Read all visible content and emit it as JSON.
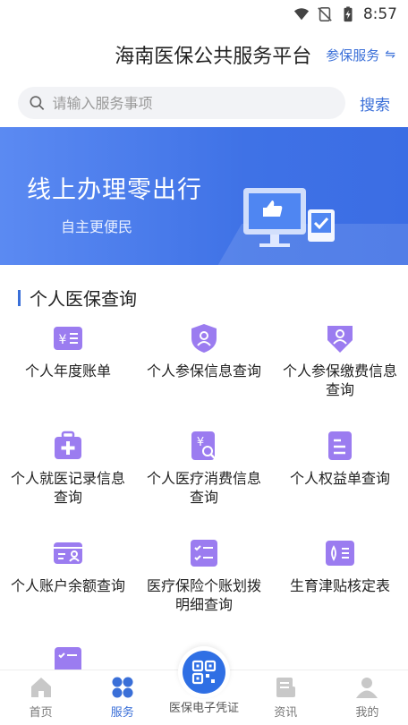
{
  "status": {
    "time": "8:57"
  },
  "header": {
    "title": "海南医保公共服务平台",
    "switch_label": "参保服务",
    "switch_icon": "swap-icon"
  },
  "search": {
    "placeholder": "请输入服务事项",
    "button": "搜索"
  },
  "banner": {
    "title": "线上办理零出行",
    "subtitle": "自主更便民"
  },
  "section": {
    "title": "个人医保查询"
  },
  "services": [
    {
      "label": "个人年度账单",
      "icon": "bill-icon"
    },
    {
      "label": "个人参保信息查询",
      "icon": "shield-user-icon"
    },
    {
      "label": "个人参保缴费信息查询",
      "icon": "payment-icon"
    },
    {
      "label": "个人就医记录信息查询",
      "icon": "medical-kit-icon"
    },
    {
      "label": "个人医疗消费信息查询",
      "icon": "consumption-search-icon"
    },
    {
      "label": "个人权益单查询",
      "icon": "document-icon"
    },
    {
      "label": "个人账户余额查询",
      "icon": "account-card-icon"
    },
    {
      "label": "医疗保险个账划拨明细查询",
      "icon": "checklist-icon"
    },
    {
      "label": "生育津贴核定表",
      "icon": "maternity-icon"
    }
  ],
  "tabs": [
    {
      "label": "首页",
      "icon": "home-icon"
    },
    {
      "label": "服务",
      "icon": "services-icon"
    },
    {
      "label": "医保电子凭证",
      "icon": "qr-code-icon"
    },
    {
      "label": "资讯",
      "icon": "news-icon"
    },
    {
      "label": "我的",
      "icon": "profile-icon"
    }
  ],
  "colors": {
    "accent": "#3a6fd8",
    "icon_purple": "#9b7cf0",
    "banner": "#4a7ce8"
  }
}
